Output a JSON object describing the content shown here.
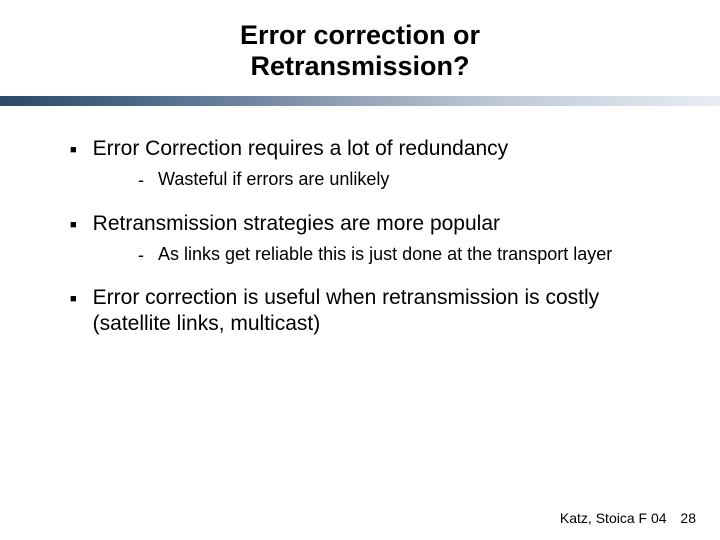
{
  "title_line1": "Error correction or",
  "title_line2": "Retransmission?",
  "bullets": [
    {
      "text": "Error Correction requires a lot of redundancy",
      "subs": [
        "Wasteful if errors are unlikely"
      ]
    },
    {
      "text": "Retransmission strategies are more popular",
      "subs": [
        "As links get reliable this is just done at the transport layer"
      ]
    },
    {
      "text": "Error correction is useful when retransmission is costly (satellite links, multicast)",
      "subs": []
    }
  ],
  "footer_author": "Katz, Stoica F 04",
  "footer_page": "28"
}
